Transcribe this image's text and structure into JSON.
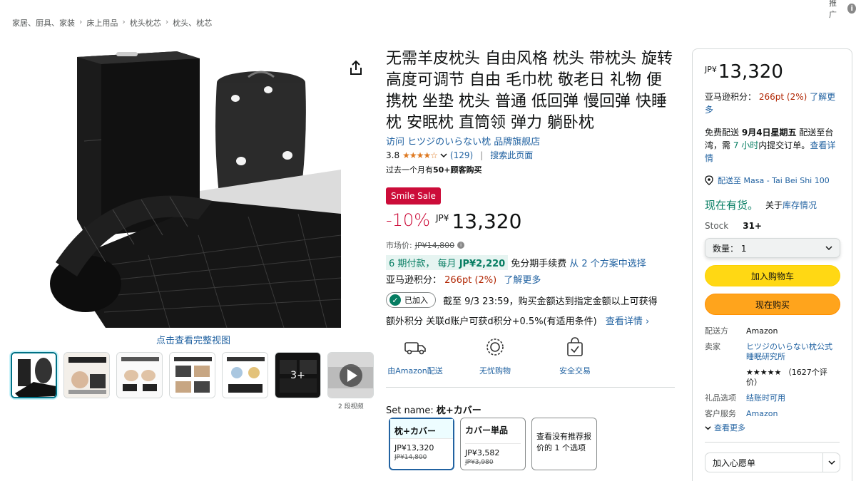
{
  "topright": {
    "text": "推广"
  },
  "breadcrumb": [
    "家居、厨具、家装",
    "床上用品",
    "枕头枕芯",
    "枕头、枕芯"
  ],
  "breadcrumb_sep": "›",
  "gallery": {
    "view_full": "点击查看完整视图",
    "more_label": "3+",
    "video_caption": "2 段视频"
  },
  "product": {
    "title": "无需羊皮枕头 自由风格 枕头 带枕头 旋转 高度可调节 自由 毛巾枕 敬老日 礼物 便携枕 坐垫 枕头 普通 低回弹 慢回弹 快睡枕 安眠枕 直筒领 弹力 躺卧枕",
    "store_link": "访问 ヒツジのいらない枕 品牌旗舰店",
    "rating": "3.8",
    "stars": "★★★★☆",
    "review_count": "(129)",
    "search_page": "搜索此页面",
    "bought_prefix": "过去一个月有",
    "bought_bold": "50+顾客购买"
  },
  "price": {
    "badge": "Smile Sale",
    "discount": "-10%",
    "currency": "JP¥",
    "value": "13,320",
    "list_label": "市场价:",
    "list_value": "JP¥14,800",
    "installment_hl": "6 期付款，  每月",
    "installment_amount": "JP¥2,220",
    "installment_rest": "免分期手续费",
    "installment_link": "从 2 个方案中选择",
    "points_label": "亚马逊积分：",
    "points_value": "266pt",
    "points_pct": "(2%)",
    "points_link": "了解更多",
    "joined_label": "已加入",
    "joined_text": "截至 9/3 23:59，购买金额达到指定金额以上可获得",
    "extra_text": "额外积分 关联d账户可获d积分+0.5%(有适用条件)",
    "extra_link": "查看详情 ›"
  },
  "features": [
    {
      "icon": "truck-icon",
      "label": "由Amazon配送"
    },
    {
      "icon": "badge-icon",
      "label": "无忧购物"
    },
    {
      "icon": "secure-bag-icon",
      "label": "安全交易"
    }
  ],
  "set": {
    "label": "Set name:",
    "selected_name": "枕+カバー",
    "options": [
      {
        "name": "枕+カバー",
        "price": "JP¥13,320",
        "old": "JP¥14,800",
        "selected": true
      },
      {
        "name": "カバー単品",
        "price": "JP¥3,582",
        "old": "JP¥3,980",
        "selected": false
      }
    ],
    "more_option": "查看没有推荐报价的 1 个选项"
  },
  "buybox": {
    "currency": "JP¥",
    "price": "13,320",
    "points_label": "亚马逊积分：",
    "points_value": "266pt",
    "points_pct": "(2%)",
    "points_link": "了解更多",
    "ship_prefix": "免费配送",
    "ship_date": "9月4日星期五",
    "ship_mid": "配送至台湾，需",
    "ship_hours": "7 小时",
    "ship_suffix": "内提交订单。",
    "ship_link": "查看详情",
    "deliver_to": "配送至 Masa - Tai Bei Shi 100",
    "in_stock": "现在有货。",
    "about": "关于",
    "about_link": "库存情况",
    "stock_label": "Stock",
    "stock_value": "31+",
    "qty_label": "数量：  1",
    "add_cart": "加入购物车",
    "buy_now": "现在购买",
    "details": [
      {
        "k": "配送方",
        "v": "Amazon",
        "link": false
      },
      {
        "k": "卖家",
        "v": "ヒツジのいらない枕公式睡眠研究所",
        "link": true
      },
      {
        "k": "",
        "v": "★★★★★ （1627个评价）",
        "link": false
      },
      {
        "k": "礼品选项",
        "v": "结账时可用",
        "link": true
      },
      {
        "k": "客户服务",
        "v": "Amazon",
        "link": true
      }
    ],
    "see_more": "查看更多",
    "wishlist": "加入心愿单"
  }
}
